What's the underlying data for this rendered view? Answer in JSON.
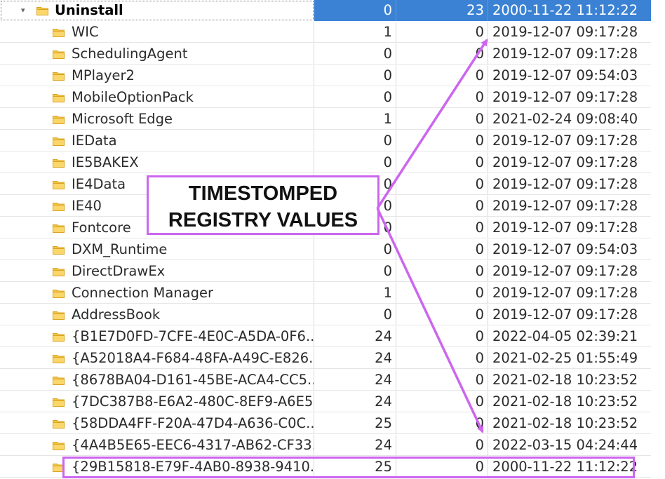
{
  "icons": {
    "folder": "folder-icon",
    "expander": "chevron-down-icon"
  },
  "colors": {
    "selection": "#3b82d4",
    "annotation": "#cc66ee",
    "folder": "#f5c542"
  },
  "callout": {
    "line1": "TIMESTOMPED",
    "line2": "REGISTRY VALUES"
  },
  "rows": [
    {
      "name": "Uninstall",
      "values": "0",
      "subkeys": "23",
      "timestamp": "2000-11-22 11:12:22",
      "selected": true
    },
    {
      "name": "WIC",
      "values": "1",
      "subkeys": "0",
      "timestamp": "2019-12-07 09:17:28"
    },
    {
      "name": "SchedulingAgent",
      "values": "0",
      "subkeys": "0",
      "timestamp": "2019-12-07 09:17:28"
    },
    {
      "name": "MPlayer2",
      "values": "0",
      "subkeys": "0",
      "timestamp": "2019-12-07 09:54:03"
    },
    {
      "name": "MobileOptionPack",
      "values": "0",
      "subkeys": "0",
      "timestamp": "2019-12-07 09:17:28"
    },
    {
      "name": "Microsoft Edge",
      "values": "1",
      "subkeys": "0",
      "timestamp": "2021-02-24 09:08:40"
    },
    {
      "name": "IEData",
      "values": "0",
      "subkeys": "0",
      "timestamp": "2019-12-07 09:17:28"
    },
    {
      "name": "IE5BAKEX",
      "values": "0",
      "subkeys": "0",
      "timestamp": "2019-12-07 09:17:28"
    },
    {
      "name": "IE4Data",
      "values": "0",
      "subkeys": "0",
      "timestamp": "2019-12-07 09:17:28"
    },
    {
      "name": "IE40",
      "values": "0",
      "subkeys": "0",
      "timestamp": "2019-12-07 09:17:28"
    },
    {
      "name": "Fontcore",
      "values": "0",
      "subkeys": "0",
      "timestamp": "2019-12-07 09:17:28"
    },
    {
      "name": "DXM_Runtime",
      "values": "0",
      "subkeys": "0",
      "timestamp": "2019-12-07 09:54:03"
    },
    {
      "name": "DirectDrawEx",
      "values": "0",
      "subkeys": "0",
      "timestamp": "2019-12-07 09:17:28"
    },
    {
      "name": "Connection Manager",
      "values": "1",
      "subkeys": "0",
      "timestamp": "2019-12-07 09:17:28"
    },
    {
      "name": "AddressBook",
      "values": "0",
      "subkeys": "0",
      "timestamp": "2019-12-07 09:17:28"
    },
    {
      "name": "{B1E7D0FD-7CFE-4E0C-A5DA-0F6...",
      "values": "24",
      "subkeys": "0",
      "timestamp": "2022-04-05 02:39:21"
    },
    {
      "name": "{A52018A4-F684-48FA-A49C-E826...",
      "values": "24",
      "subkeys": "0",
      "timestamp": "2021-02-25 01:55:49"
    },
    {
      "name": "{8678BA04-D161-45BE-ACA4-CC5...",
      "values": "24",
      "subkeys": "0",
      "timestamp": "2021-02-18 10:23:52"
    },
    {
      "name": "{7DC387B8-E6A2-480C-8EF9-A6E5...",
      "values": "24",
      "subkeys": "0",
      "timestamp": "2021-02-18 10:23:52"
    },
    {
      "name": "{58DDA4FF-F20A-47D4-A636-C0C...",
      "values": "25",
      "subkeys": "0",
      "timestamp": "2021-02-18 10:23:52"
    },
    {
      "name": "{4A4B5E65-EEC6-4317-AB62-CF33...",
      "values": "24",
      "subkeys": "0",
      "timestamp": "2022-03-15 04:24:44"
    },
    {
      "name": "{29B15818-E79F-4AB0-8938-9410...",
      "values": "25",
      "subkeys": "0",
      "timestamp": "2000-11-22 11:12:22"
    }
  ]
}
